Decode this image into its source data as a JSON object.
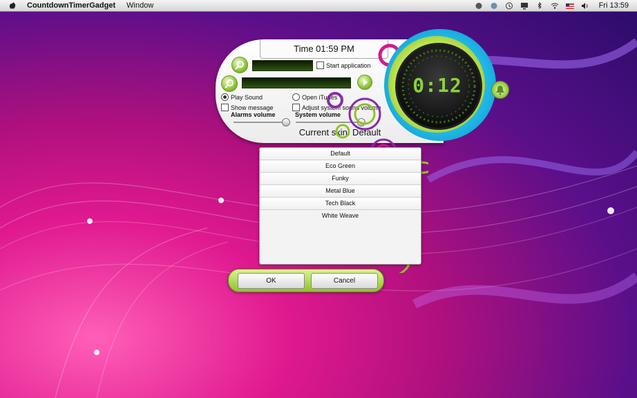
{
  "menubar": {
    "app_name": "CountdownTimerGadget",
    "menus": [
      "Window"
    ],
    "clock": "Fri 13:59"
  },
  "widget": {
    "time_label": "Time 01:59 PM",
    "start_application_label": "Start application",
    "play_sound_label": "Play Sound",
    "open_itunes_label": "Open iTunes",
    "show_message_label": "Show message",
    "adjust_volume_label": "Adjust system sound volume",
    "alarms_volume_label": "Alarms volume",
    "system_volume_label": "System volume",
    "current_skin_label": "Current skin: Default",
    "countdown_display": "0:12"
  },
  "skins": {
    "items": [
      "Default",
      "Eco Green",
      "Funky",
      "Metal Blue",
      "Tech Black",
      "White Weave"
    ]
  },
  "buttons": {
    "ok": "OK",
    "cancel": "Cancel"
  },
  "colors": {
    "accent_green": "#8fc22c",
    "accent_blue": "#1fb8e6",
    "accent_magenta": "#d31a8c",
    "accent_purple": "#8a2aa8"
  }
}
